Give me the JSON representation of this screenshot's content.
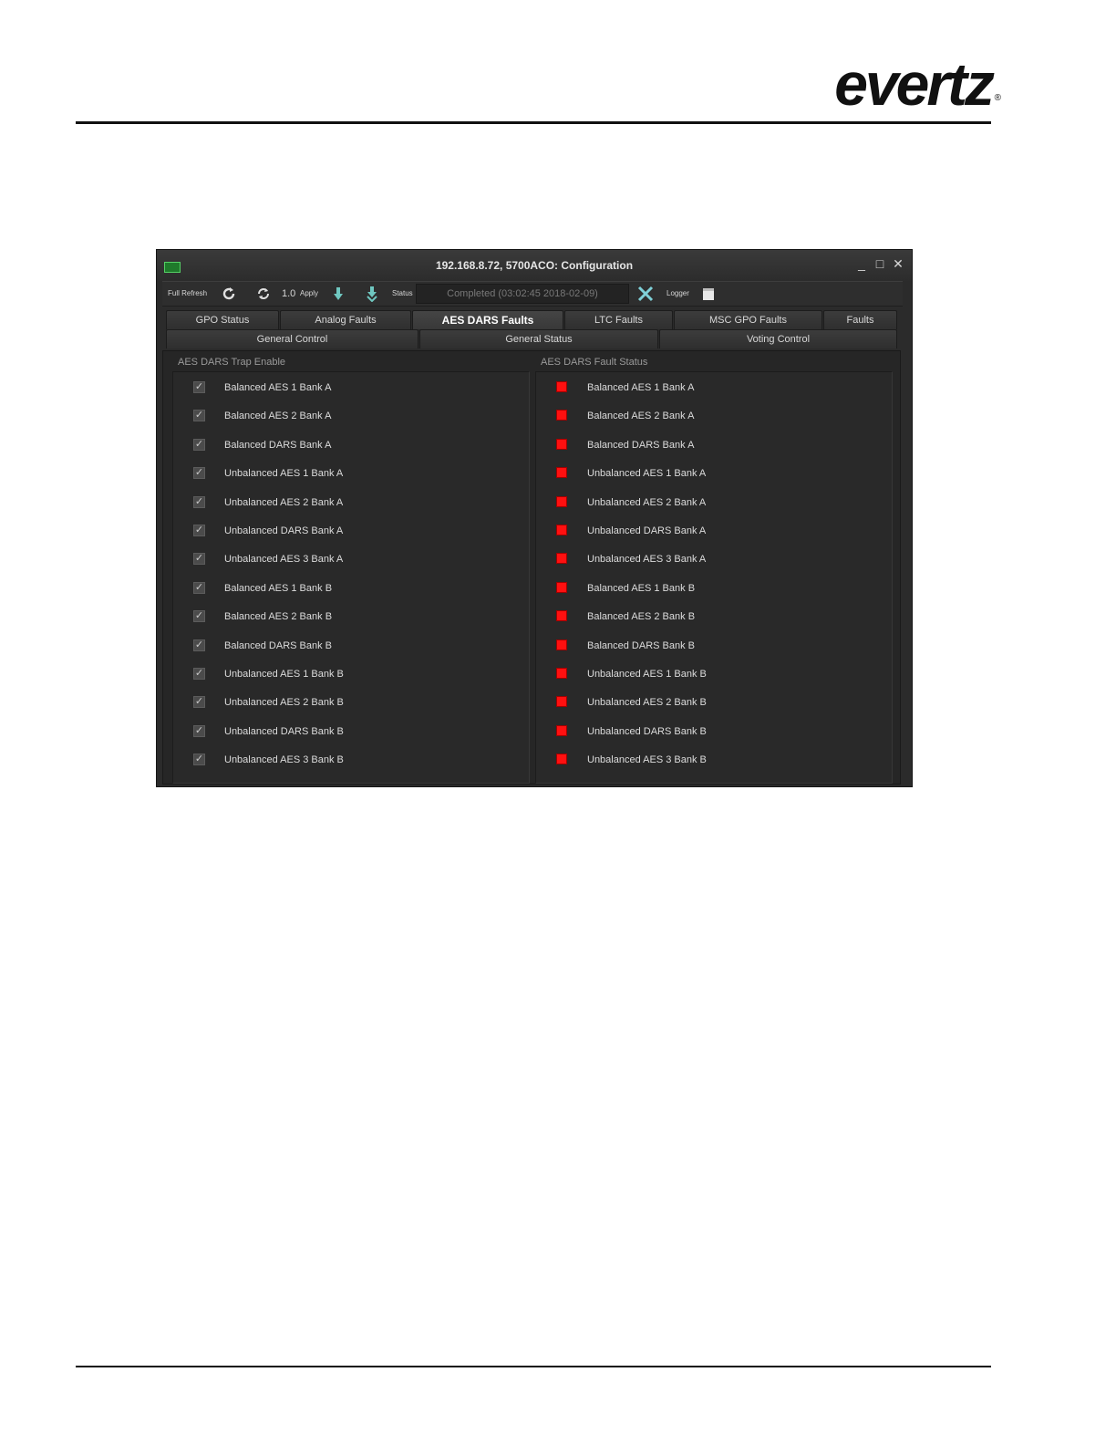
{
  "logo": {
    "text": "evertz",
    "mark": "®"
  },
  "window": {
    "title": "192.168.8.72, 5700ACO: Configuration",
    "app_icon": "green-card-icon",
    "controls": {
      "minimize": "_",
      "maximize": "□",
      "close": "✕"
    }
  },
  "toolbar": {
    "full_refresh": "Full Refresh",
    "refresh_icon": "refresh-icon",
    "auto_refresh_icon": "cycle-icon",
    "version": "1.0",
    "apply": "Apply",
    "download_icon": "down-arrow-icon",
    "download_all_icon": "double-down-arrow-icon",
    "status_label": "Status",
    "status_value": "Completed  (03:02:45 2018-02-09)",
    "cancel_icon": "x-icon",
    "logger": "Logger",
    "logger_icon": "notepad-icon"
  },
  "tabs_row1": [
    "GPO Status",
    "Analog Faults",
    "AES DARS Faults",
    "LTC Faults",
    "MSC GPO Faults",
    "Faults"
  ],
  "tabs_row2": [
    "General Control",
    "General Status",
    "Voting Control"
  ],
  "active_tab": "AES DARS Faults",
  "trap_group": {
    "title": "AES DARS Trap Enable",
    "items": [
      "Balanced AES 1 Bank A",
      "Balanced AES 2 Bank A",
      "Balanced DARS Bank A",
      "Unbalanced AES 1 Bank A",
      "Unbalanced AES 2 Bank A",
      "Unbalanced DARS Bank A",
      "Unbalanced AES 3 Bank A",
      "Balanced AES 1 Bank B",
      "Balanced AES 2 Bank B",
      "Balanced DARS Bank B",
      "Unbalanced AES 1 Bank B",
      "Unbalanced AES 2 Bank B",
      "Unbalanced DARS Bank B",
      "Unbalanced AES 3 Bank B"
    ],
    "checked": true
  },
  "fault_group": {
    "title": "AES DARS Fault Status",
    "items": [
      "Balanced AES 1 Bank A",
      "Balanced AES 2 Bank A",
      "Balanced DARS Bank A",
      "Unbalanced AES 1 Bank A",
      "Unbalanced AES 2 Bank A",
      "Unbalanced DARS Bank A",
      "Unbalanced AES 3 Bank A",
      "Balanced AES 1 Bank B",
      "Balanced AES 2 Bank B",
      "Balanced DARS Bank B",
      "Unbalanced AES 1 Bank B",
      "Unbalanced AES 2 Bank B",
      "Unbalanced DARS Bank B",
      "Unbalanced AES 3 Bank B"
    ],
    "led_color": "#ff1010"
  }
}
